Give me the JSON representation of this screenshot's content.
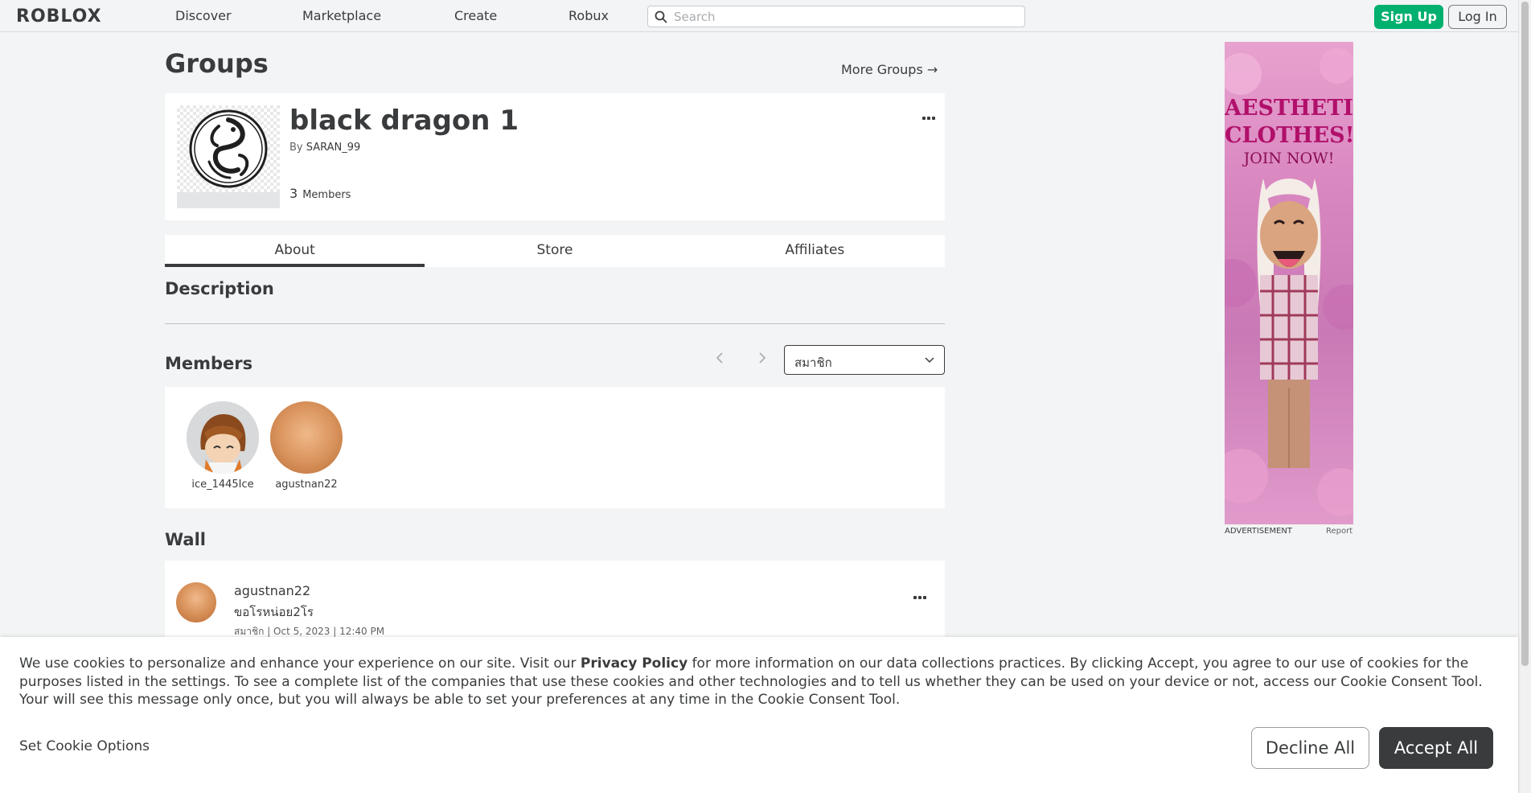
{
  "nav": {
    "logo": "ROBLOX",
    "links": [
      "Discover",
      "Marketplace",
      "Create",
      "Robux"
    ],
    "search_placeholder": "Search",
    "signup": "Sign Up",
    "login": "Log In"
  },
  "page": {
    "title": "Groups",
    "more_groups": "More Groups →"
  },
  "group": {
    "name": "black dragon 1",
    "by_prefix": "By",
    "owner": "SARAN_99",
    "member_count": "3",
    "members_label": "Members"
  },
  "tabs": [
    {
      "label": "About",
      "active": true
    },
    {
      "label": "Store",
      "active": false
    },
    {
      "label": "Affiliates",
      "active": false
    }
  ],
  "description": {
    "heading": "Description"
  },
  "members": {
    "heading": "Members",
    "role_select": "สมาชิก",
    "list": [
      {
        "name": "ice_1445Ice"
      },
      {
        "name": "agustnan22"
      }
    ]
  },
  "wall": {
    "heading": "Wall",
    "posts": [
      {
        "user": "agustnan22",
        "message": "ขอโรหน่อย2โร",
        "meta": "สมาชิก | Oct 5, 2023 | 12:40 PM"
      }
    ]
  },
  "ad": {
    "title_line1": "AESTHETIC",
    "title_line2": "CLOTHES!",
    "subtitle": "JOIN NOW!",
    "label": "ADVERTISEMENT",
    "report": "Report"
  },
  "cookie": {
    "text_before": "We use cookies to personalize and enhance your experience on our site. Visit our ",
    "policy_link": "Privacy Policy",
    "text_after": " for more information on our data collections practices. By clicking Accept, you agree to our use of cookies for the purposes listed in the settings. To see a complete list of the companies that use these cookies and other technologies and to tell us whether they can be used on your device or not, access our Cookie Consent Tool. Your will see this message only once, but you will always be able to set your preferences at any time in the Cookie Consent Tool.",
    "options": "Set Cookie Options",
    "decline": "Decline All",
    "accept": "Accept All"
  }
}
